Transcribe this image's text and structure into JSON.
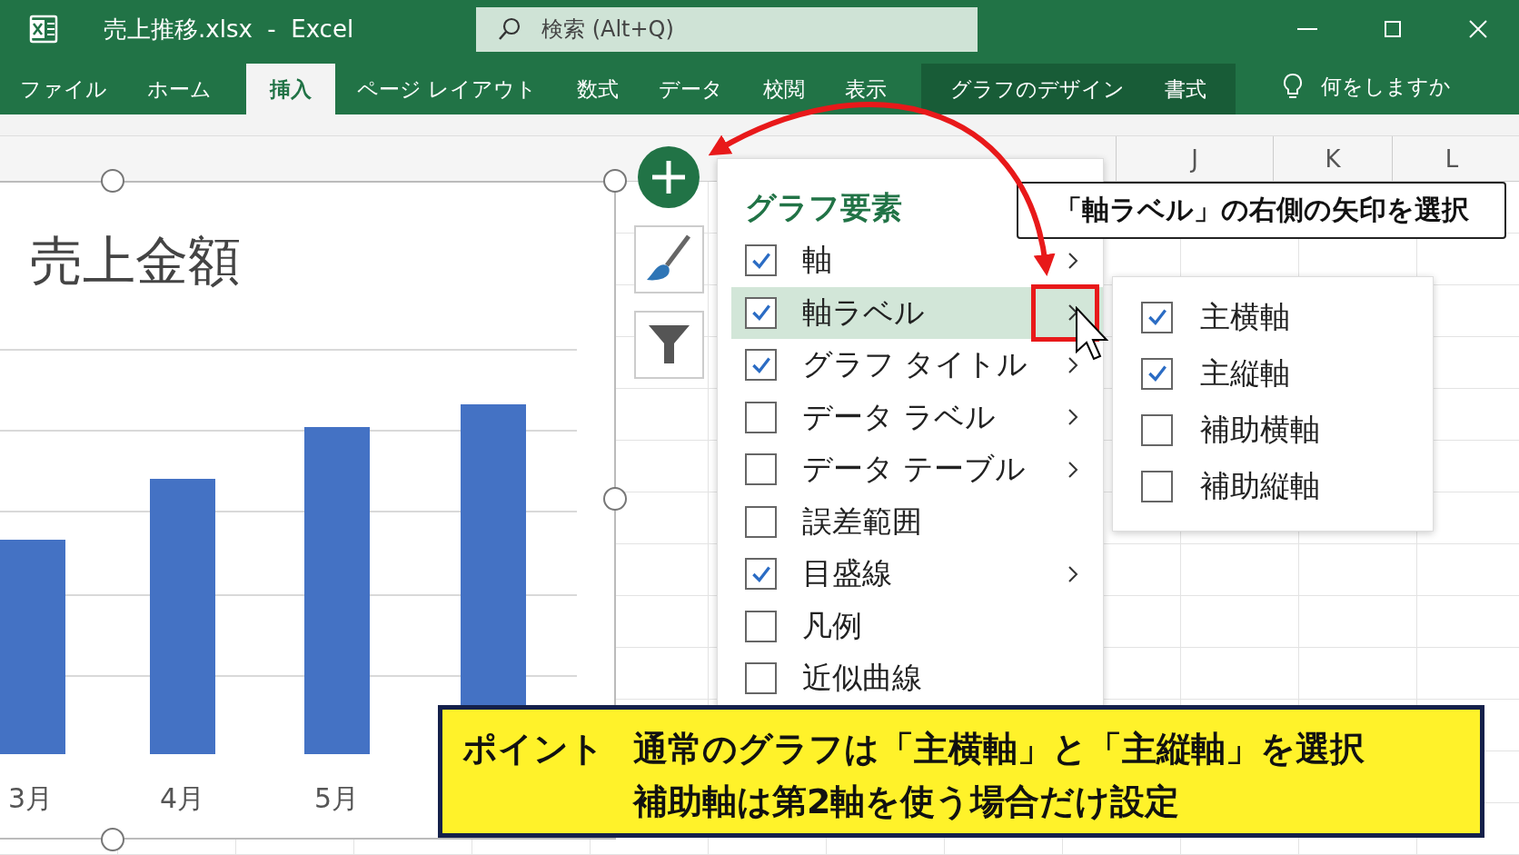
{
  "window": {
    "title": "売上推移.xlsx  -  Excel",
    "search_placeholder": "検索 (Alt+Q)"
  },
  "ribbon_tabs": [
    {
      "label": "ファイル",
      "selected": false,
      "contextual": false
    },
    {
      "label": "ホーム",
      "selected": false,
      "contextual": false
    },
    {
      "label": "挿入",
      "selected": true,
      "contextual": false
    },
    {
      "label": "ページ レイアウト",
      "selected": false,
      "contextual": false
    },
    {
      "label": "数式",
      "selected": false,
      "contextual": false
    },
    {
      "label": "データ",
      "selected": false,
      "contextual": false
    },
    {
      "label": "校閲",
      "selected": false,
      "contextual": false
    },
    {
      "label": "表示",
      "selected": false,
      "contextual": false
    },
    {
      "label": "グラフのデザイン",
      "selected": false,
      "contextual": true
    },
    {
      "label": "書式",
      "selected": false,
      "contextual": true
    }
  ],
  "tell_me": "何をしますか",
  "column_headers": [
    "J",
    "K",
    "L"
  ],
  "chart": {
    "title": "売上金額",
    "x_labels": [
      "3月",
      "4月",
      "5月"
    ]
  },
  "chart_elements_panel": {
    "heading": "グラフ要素",
    "items": [
      {
        "label": "軸",
        "checked": true,
        "has_submenu": true,
        "selected": false
      },
      {
        "label": "軸ラベル",
        "checked": true,
        "has_submenu": true,
        "selected": true
      },
      {
        "label": "グラフ タイトル",
        "checked": true,
        "has_submenu": true,
        "selected": false
      },
      {
        "label": "データ ラベル",
        "checked": false,
        "has_submenu": true,
        "selected": false
      },
      {
        "label": "データ テーブル",
        "checked": false,
        "has_submenu": true,
        "selected": false
      },
      {
        "label": "誤差範囲",
        "checked": false,
        "has_submenu": false,
        "selected": false
      },
      {
        "label": "目盛線",
        "checked": true,
        "has_submenu": true,
        "selected": false
      },
      {
        "label": "凡例",
        "checked": false,
        "has_submenu": false,
        "selected": false
      },
      {
        "label": "近似曲線",
        "checked": false,
        "has_submenu": false,
        "selected": false
      }
    ]
  },
  "axis_label_submenu": {
    "items": [
      {
        "label": "主横軸",
        "checked": true
      },
      {
        "label": "主縦軸",
        "checked": true
      },
      {
        "label": "補助横軸",
        "checked": false
      },
      {
        "label": "補助縦軸",
        "checked": false
      }
    ]
  },
  "callout": "「軸ラベル」の右側の矢印を選択",
  "point_note": {
    "tag": "ポイント",
    "lines": [
      "通常のグラフは「主横軸」と「主縦軸」を選択",
      "補助軸は第2軸を使う場合だけ設定"
    ]
  }
}
